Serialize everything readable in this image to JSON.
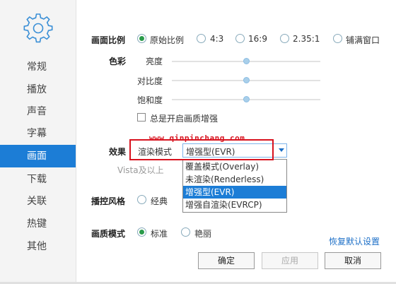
{
  "sidebar": {
    "icon": "gear-icon",
    "items": [
      {
        "label": "常规"
      },
      {
        "label": "播放"
      },
      {
        "label": "声音"
      },
      {
        "label": "字幕"
      },
      {
        "label": "画面",
        "active": true
      },
      {
        "label": "下载"
      },
      {
        "label": "关联"
      },
      {
        "label": "热键"
      },
      {
        "label": "其他"
      }
    ]
  },
  "aspect": {
    "label": "画面比例",
    "options": [
      "原始比例",
      "4:3",
      "16:9",
      "2.35:1",
      "铺满窗口"
    ],
    "selected": "原始比例"
  },
  "color": {
    "label": "色彩",
    "sliders": [
      {
        "label": "亮度",
        "value": 0.5
      },
      {
        "label": "对比度",
        "value": 0.5
      },
      {
        "label": "饱和度",
        "value": 0.5
      }
    ],
    "checkbox_label": "总是开启画质增强",
    "checked": false
  },
  "effect": {
    "label": "效果",
    "render_label": "渲染模式",
    "selected": "增强型(EVR)",
    "hint": "Vista及以上",
    "options": [
      "覆盖模式(Overlay)",
      "未渲染(Renderless)",
      "增强型(EVR)",
      "增强自渲染(EVRCP)"
    ]
  },
  "watermark": "www.qinpinchang.com",
  "control_style": {
    "label": "播控风格",
    "option": "经典"
  },
  "quality": {
    "label": "画质模式",
    "options": [
      "标准",
      "艳丽"
    ],
    "selected": "标准"
  },
  "restore_link": "恢复默认设置",
  "buttons": {
    "ok": "确定",
    "apply": "应用",
    "cancel": "取消"
  },
  "colors": {
    "accent": "#1c7dd6",
    "radio_on": "#2a9b4a",
    "highlight_box": "#d8121e"
  }
}
